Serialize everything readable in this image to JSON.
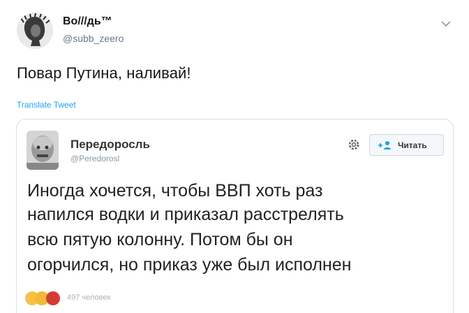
{
  "tweet": {
    "name": "Во///дь™",
    "handle": "@subb_zeero",
    "text": "Повар Путина, наливай!",
    "translate_label": "Translate Tweet"
  },
  "quoted": {
    "name": "Передоросль",
    "handle": "@Peredorosl",
    "follow_label": "Читать",
    "lines": [
      "Иногда хочется, чтобы ВВП хоть раз",
      "напился водки и приказал расстрелять",
      "всю пятую колонну. Потом бы он",
      "огорчился, но приказ уже был исполнен"
    ],
    "reactions_count": "497 человек"
  },
  "colors": {
    "link": "#1da1f2",
    "secondary_text": "#657786",
    "border": "#d9dee3"
  },
  "icons": [
    "chevron-down-icon",
    "gear-icon",
    "follow-user-icon"
  ]
}
